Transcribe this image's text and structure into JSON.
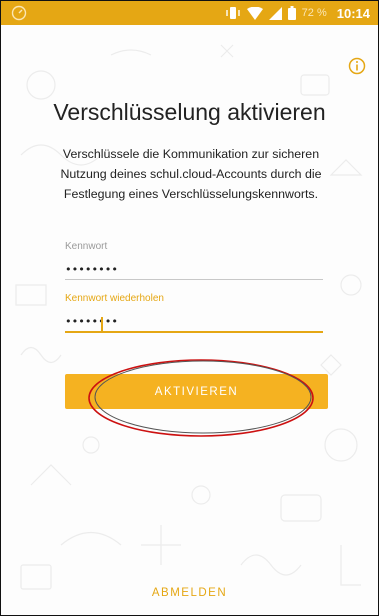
{
  "status_bar": {
    "battery_percent": "72 %",
    "time": "10:14",
    "left_icon": "gauge-icon",
    "icons": [
      "vibrate-icon",
      "wifi-icon",
      "signal-icon",
      "battery-icon"
    ],
    "color": "#e5a714"
  },
  "info_icon": "info-icon",
  "title": "Verschlüsselung aktivieren",
  "description": "Verschlüssele die Kommunikation zur sicheren Nutzung deines schul.cloud-Accounts durch die Festlegung eines Verschlüsselungskennworts.",
  "password_field": {
    "label": "Kennwort",
    "value": "••••••••"
  },
  "repeat_field": {
    "label": "Kennwort wiederholen",
    "value": "••••••••"
  },
  "activate_button": {
    "label": "AKTIVIEREN"
  },
  "logout_button": {
    "label": "ABMELDEN"
  },
  "colors": {
    "accent": "#e5a714",
    "button": "#f5b221",
    "annotation": "#cc1111"
  }
}
